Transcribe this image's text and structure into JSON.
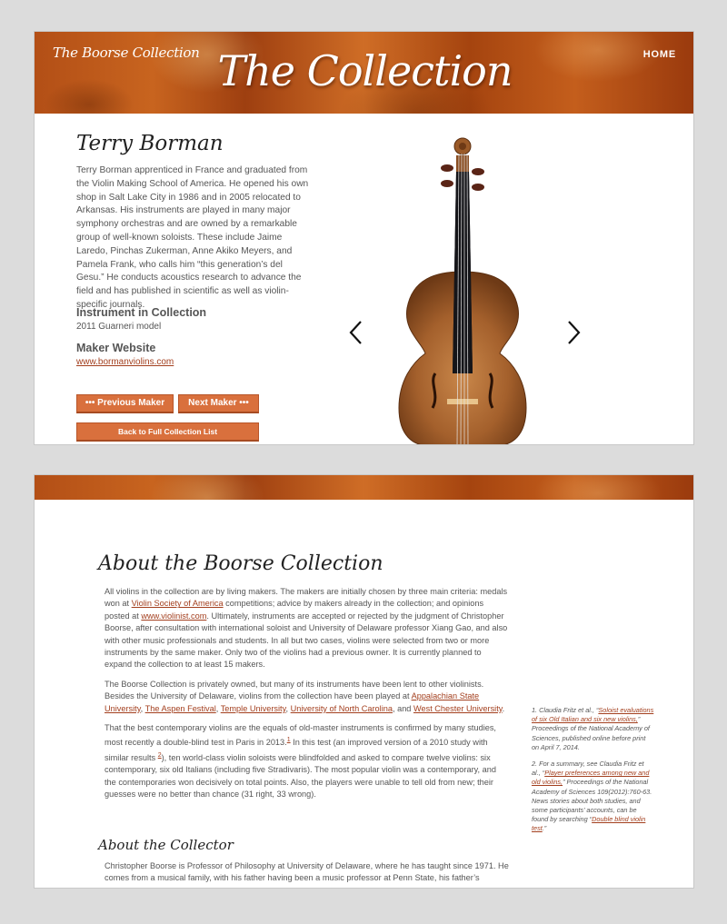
{
  "header": {
    "site_logo": "The Boorse Collection",
    "page_title": "The Collection",
    "nav_home": "HOME"
  },
  "maker": {
    "name": "Terry Borman",
    "bio": "Terry Borman apprenticed in France and graduated from the Violin Making School of America. He opened his own shop in Salt Lake City in 1986 and in 2005 relocated to Arkansas. His instruments are played in many major symphony orchestras and are owned by a remarkable group of well-known soloists. These include Jaime Laredo, Pinchas Zukerman, Anne Akiko Meyers, and Pamela Frank, who calls him “this generation’s del Gesu.” He conducts acoustics research to advance the field and has published in scientific as well as violin-specific journals.",
    "instrument_heading": "Instrument in Collection",
    "instrument_value": "2011 Guarneri model",
    "website_heading": "Maker Website",
    "website_link": "www.bormanviolins.com"
  },
  "buttons": {
    "previous": "••• Previous Maker",
    "next": "Next Maker •••",
    "back": "Back to Full Collection List"
  },
  "gallery": {
    "prev_icon": "chevron-left-icon",
    "next_icon": "chevron-right-icon"
  },
  "about": {
    "heading": "About the Boorse Collection",
    "p1": {
      "a": "All violins in the collection are by living makers. The makers are initially chosen by three main criteria: medals won at ",
      "link1": "Violin Society of America",
      "b": " competitions; advice by makers already in the collection; and opinions posted at ",
      "link2": "www.violinist.com",
      "c": ". Ultimately, instruments are accepted or rejected by the judgment of Christopher Boorse, after consultation with international soloist and University of Delaware professor Xiang Gao, and also with other music professionals and students. In all but two cases, violins were selected from two or more instruments by the same maker. Only two of the violins had a previous owner. It is currently planned to expand the collection to at least 15 makers."
    },
    "p2": {
      "a": "The Boorse Collection is privately owned, but many of its instruments have been lent to other violinists. Besides the University of Delaware, violins from the collection have been played at ",
      "link1": "Appalachian State University",
      "sep1": ", ",
      "link2": "The Aspen Festival",
      "sep2": ", ",
      "link3": "Temple University",
      "sep3": ", ",
      "link4": "University of North Carolina",
      "sep4": ", and ",
      "link5": "West Chester University",
      "end": "."
    },
    "p3": {
      "a": "That the best contemporary violins are the equals of old-master instruments is confirmed by many studies, most recently a double-blind test in Paris in 2013.",
      "ref1": "1",
      "b": " In this test (an improved version of a 2010 study with similar results ",
      "ref2": "2",
      "c": "), ten world-class violin soloists were blindfolded and asked to compare twelve violins: six contemporary, six old Italians (including five Stradivaris). The most popular violin was a contemporary, and the contemporaries won decisively on total points. Also, the players were unable to tell old from new; their guesses were no better than chance (31 right, 33 wrong)."
    }
  },
  "footnotes": {
    "fn1": {
      "a": "1. Claudia Fritz et al., “",
      "link": "Soloist evaluations of six Old Italian and six new violins,",
      "b": "” Proceedings of the National Academy of Sciences, published online before print on April 7, 2014."
    },
    "fn2": {
      "a": "2. For a summary, see Claudia Fritz et al., “",
      "link": "Player preferences among new and old violins,",
      "b": "” Proceedings of the National Academy of Sciences 109(2012):760-63. News stories about both studies, and some participants’ accounts, can be found by searching “",
      "link2": "Double blind violin test",
      "c": ".”"
    }
  },
  "collector": {
    "heading": "About the Collector",
    "text": "Christopher Boorse is Professor of Philosophy at University of Delaware, where he has taught since 1971. He comes from a musical family, with his father having been a music professor at Penn State, his father’s parents"
  },
  "colors": {
    "accent": "#d9703d",
    "link": "#a33f1e",
    "wood": "#b34f16",
    "text": "#555555"
  }
}
